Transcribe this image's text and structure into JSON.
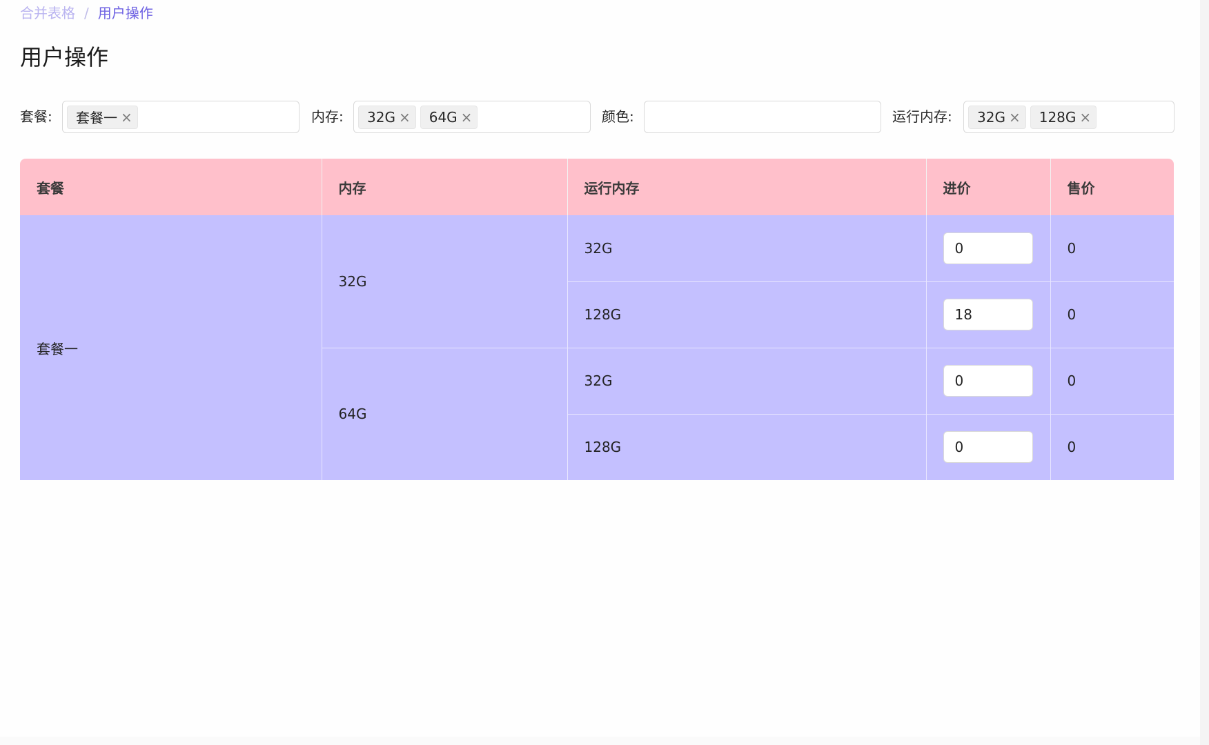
{
  "breadcrumb": {
    "parent": "合并表格",
    "separator": "/",
    "current": "用户操作"
  },
  "page_title": "用户操作",
  "filters": {
    "package": {
      "label": "套餐:",
      "tags": [
        "套餐一"
      ]
    },
    "memory": {
      "label": "内存:",
      "tags": [
        "32G",
        "64G"
      ]
    },
    "color": {
      "label": "颜色:",
      "tags": []
    },
    "ram": {
      "label": "运行内存:",
      "tags": [
        "32G",
        "128G"
      ]
    },
    "close_glyph": "×"
  },
  "table": {
    "headers": [
      "套餐",
      "内存",
      "运行内存",
      "进价",
      "售价"
    ],
    "package": "套餐一",
    "memory_groups": [
      {
        "memory": "32G",
        "rows": [
          {
            "ram": "32G",
            "cost": "0",
            "price": "0"
          },
          {
            "ram": "128G",
            "cost": "18",
            "price": "0"
          }
        ]
      },
      {
        "memory": "64G",
        "rows": [
          {
            "ram": "32G",
            "cost": "0",
            "price": "0"
          },
          {
            "ram": "128G",
            "cost": "0",
            "price": "0"
          }
        ]
      }
    ]
  },
  "colors": {
    "header_bg": "#ffc0cb",
    "body_bg": "#c4c0ff",
    "breadcrumb_current": "#6f63e3",
    "breadcrumb_parent": "#b9b3f0"
  }
}
